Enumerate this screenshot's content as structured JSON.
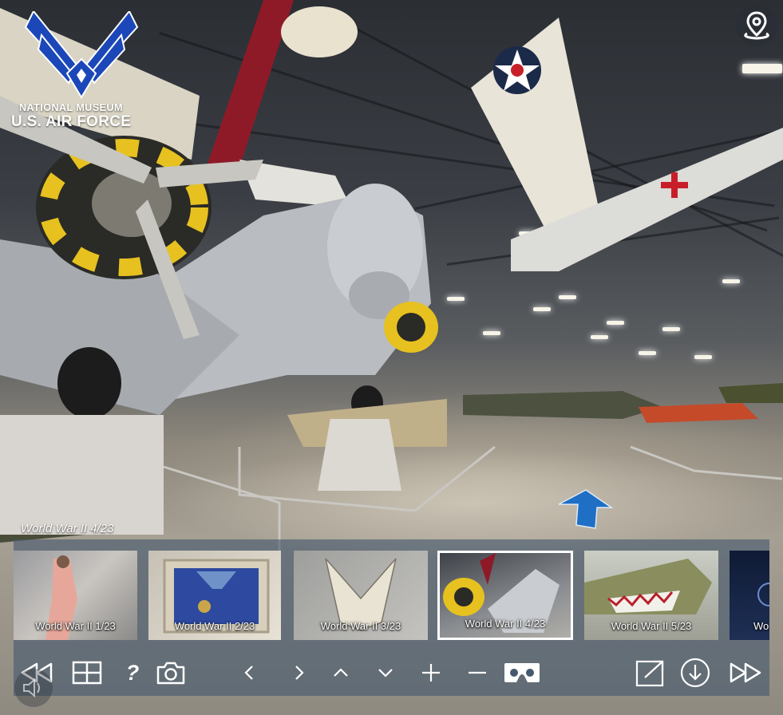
{
  "logo": {
    "line1": "NATIONAL MUSEUM",
    "line2": "U.S. AIR FORCE"
  },
  "current_scene_title": "World War II 4/23",
  "thumbnails": [
    {
      "label": "World War II 1/23",
      "selected": false
    },
    {
      "label": "World War II 2/23",
      "selected": false
    },
    {
      "label": "World War II 3/23",
      "selected": false
    },
    {
      "label": "World War II 4/23",
      "selected": true
    },
    {
      "label": "World War II 5/23",
      "selected": false
    },
    {
      "label": "Wo",
      "selected": false
    }
  ],
  "controls": {
    "help_label": "?"
  },
  "colors": {
    "panel": "#46586e",
    "hotspot_arrow": "#1f6fc4",
    "logo_blue": "#1c47b8"
  }
}
